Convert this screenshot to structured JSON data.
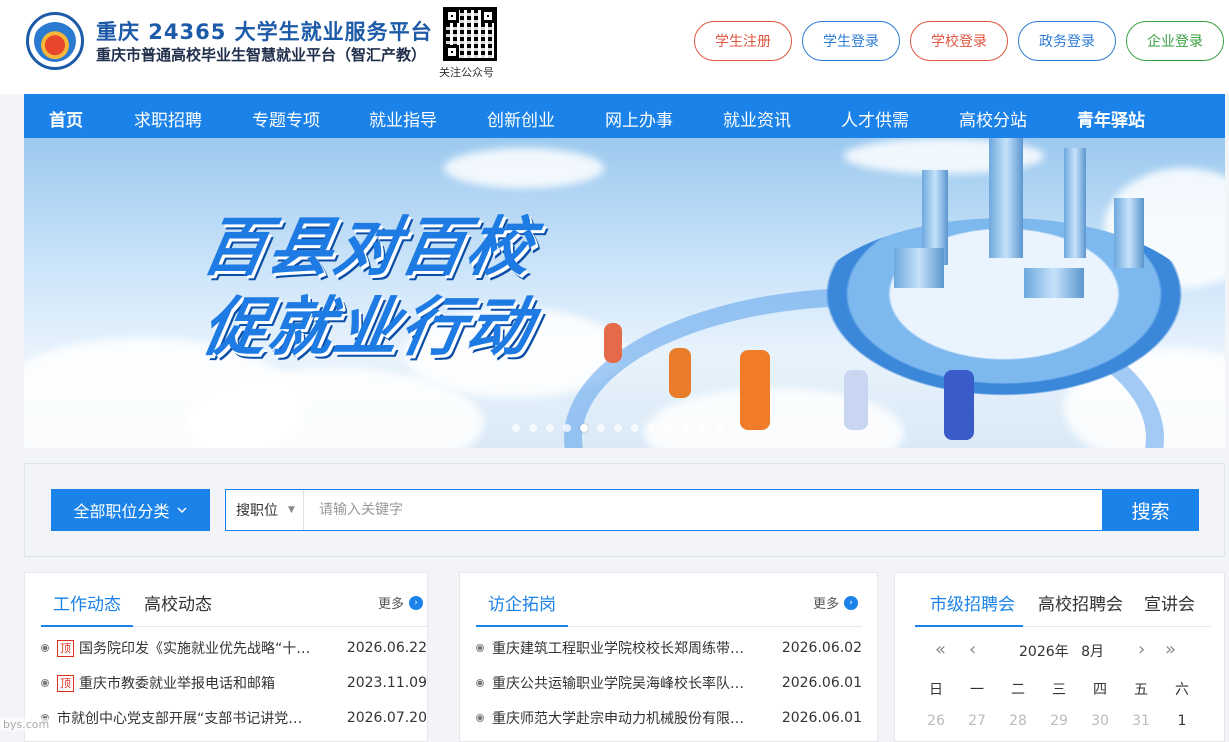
{
  "header": {
    "title": "重庆 24365 大学生就业服务平台",
    "subtitle": "重庆市普通高校毕业生智慧就业平台（智汇产教）",
    "qr_caption": "关注公众号",
    "buttons": [
      {
        "label": "学生注册",
        "color": "#e0553f"
      },
      {
        "label": "学生登录",
        "color": "#2e7bd6"
      },
      {
        "label": "学校登录",
        "color": "#e0553f"
      },
      {
        "label": "政务登录",
        "color": "#2e7bd6"
      },
      {
        "label": "企业登录",
        "color": "#3aa142"
      }
    ]
  },
  "nav": {
    "items": [
      "首页",
      "求职招聘",
      "专题专项",
      "就业指导",
      "创新创业",
      "网上办事",
      "就业资讯",
      "人才供需",
      "高校分站",
      "青年驿站"
    ],
    "bg_color": "#1a82e8"
  },
  "banner": {
    "line1": "百县对百校",
    "line2": "促就业行动",
    "dot_count": 14,
    "active_dot": 4
  },
  "search": {
    "category_label": "全部职位分类",
    "type_label": "搜职位",
    "placeholder": "请输入关键字",
    "button_label": "搜索"
  },
  "panel_news": {
    "tabs": [
      "工作动态",
      "高校动态"
    ],
    "more_label": "更多",
    "items": [
      {
        "top": true,
        "top_label": "顶",
        "title": "国务院印发《实施就业优先战略“十…",
        "date": "2026.06.22"
      },
      {
        "top": true,
        "top_label": "顶",
        "title": "重庆市教委就业举报电话和邮箱",
        "date": "2023.11.09"
      },
      {
        "top": false,
        "title": "市就创中心党支部开展“支部书记讲党…",
        "date": "2026.07.20"
      }
    ]
  },
  "panel_visit": {
    "tabs": [
      "访企拓岗"
    ],
    "more_label": "更多",
    "items": [
      {
        "title": "重庆建筑工程职业学院校校长郑周练带…",
        "date": "2026.06.02"
      },
      {
        "title": "重庆公共运输职业学院吴海峰校长率队…",
        "date": "2026.06.01"
      },
      {
        "title": "重庆师范大学赴宗申动力机械股份有限…",
        "date": "2026.06.01"
      }
    ]
  },
  "panel_calendar": {
    "tabs": [
      "市级招聘会",
      "高校招聘会",
      "宣讲会"
    ],
    "year_label": "2026年",
    "month_label": "8月",
    "weekdays": [
      "日",
      "一",
      "二",
      "三",
      "四",
      "五",
      "六"
    ],
    "first_row": [
      "26",
      "27",
      "28",
      "29",
      "30",
      "31",
      "1"
    ]
  },
  "watermark": "bys.com"
}
